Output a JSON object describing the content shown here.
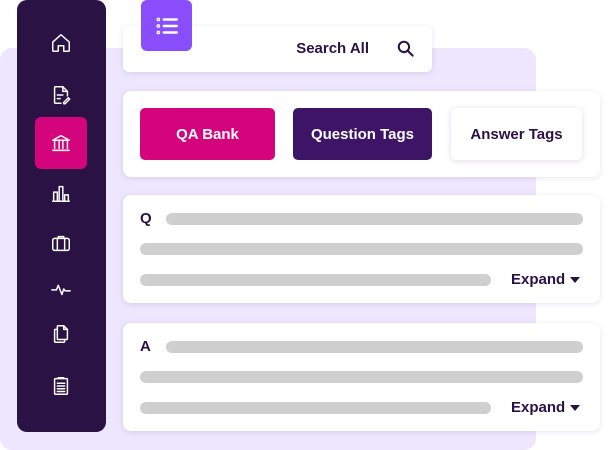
{
  "sidebar": {
    "items": [
      {
        "icon": "home-icon",
        "active": false
      },
      {
        "icon": "document-edit-icon",
        "active": false
      },
      {
        "icon": "bank-icon",
        "active": true
      },
      {
        "icon": "bar-chart-icon",
        "active": false
      },
      {
        "icon": "briefcase-icon",
        "active": false
      },
      {
        "icon": "activity-icon",
        "active": false
      },
      {
        "icon": "copy-files-icon",
        "active": false
      },
      {
        "icon": "clipboard-icon",
        "active": false
      }
    ]
  },
  "header": {
    "menu_icon": "list-menu-icon",
    "search_label": "Search All",
    "search_icon": "search-icon"
  },
  "tabs": [
    {
      "label": "QA Bank",
      "active": true
    },
    {
      "label": "Question Tags",
      "active": false
    },
    {
      "label": "Answer Tags",
      "active": false
    }
  ],
  "question_card": {
    "letter": "Q",
    "expand_label": "Expand",
    "expand_icon": "caret-down-icon"
  },
  "answer_card": {
    "letter": "A",
    "expand_label": "Expand",
    "expand_icon": "caret-down-icon"
  },
  "colors": {
    "sidebar_bg": "#2a1245",
    "accent_pink": "#d4047c",
    "accent_purple": "#8a4dfc",
    "dark_purple_tab": "#3d1466",
    "background_panel": "#ede6fd",
    "placeholder_bar": "#cfcfcf"
  }
}
